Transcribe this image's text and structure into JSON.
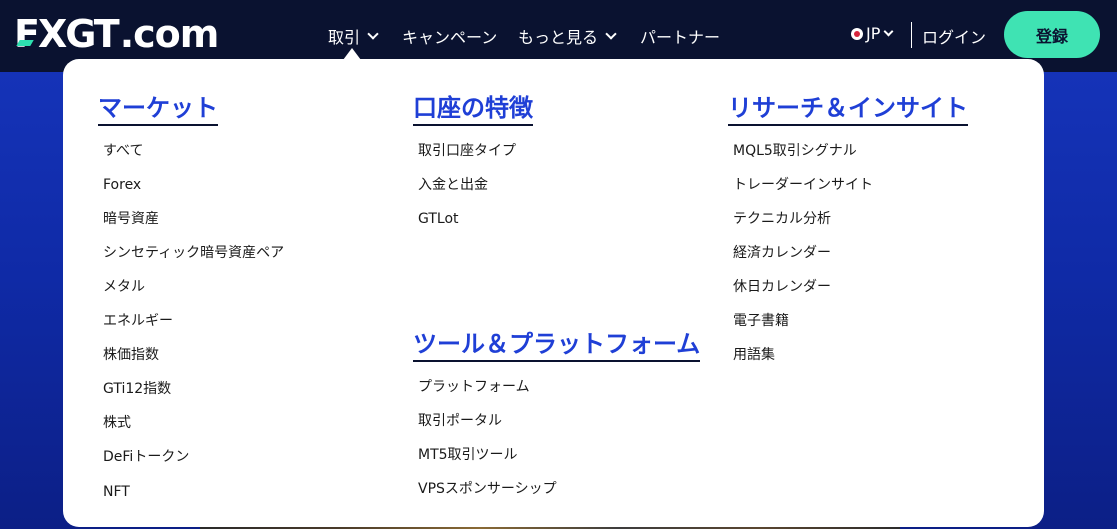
{
  "header": {
    "logo_main": "FXGT",
    "logo_suffix": ".com",
    "nav": [
      {
        "label": "取引"
      },
      {
        "label": "キャンペーン"
      },
      {
        "label": "もっと見る"
      },
      {
        "label": "パートナー"
      }
    ],
    "language": "JP",
    "login": "ログイン",
    "register": "登録"
  },
  "menu": {
    "markets": {
      "title": "マーケット",
      "items": [
        "すべて",
        "Forex",
        "暗号資産",
        "シンセティック暗号資産ペア",
        "メタル",
        "エネルギー",
        "株価指数",
        "GTi12指数",
        "株式",
        "DeFiトークン",
        "NFT"
      ]
    },
    "accounts": {
      "title": "口座の特徴",
      "items": [
        "取引口座タイプ",
        "入金と出金",
        "GTLot"
      ]
    },
    "tools": {
      "title": "ツール＆プラットフォーム",
      "items": [
        "プラットフォーム",
        "取引ポータル",
        "MT5取引ツール",
        "VPSスポンサーシップ"
      ]
    },
    "research": {
      "title": "リサーチ＆インサイト",
      "items": [
        "MQL5取引シグナル",
        "トレーダーインサイト",
        "テクニカル分析",
        "経済カレンダー",
        "休日カレンダー",
        "電子書籍",
        "用語集"
      ]
    }
  },
  "colors": {
    "accent": "#3fe3b3",
    "heading": "#1f3fd6",
    "topbar": "#0a1230"
  }
}
